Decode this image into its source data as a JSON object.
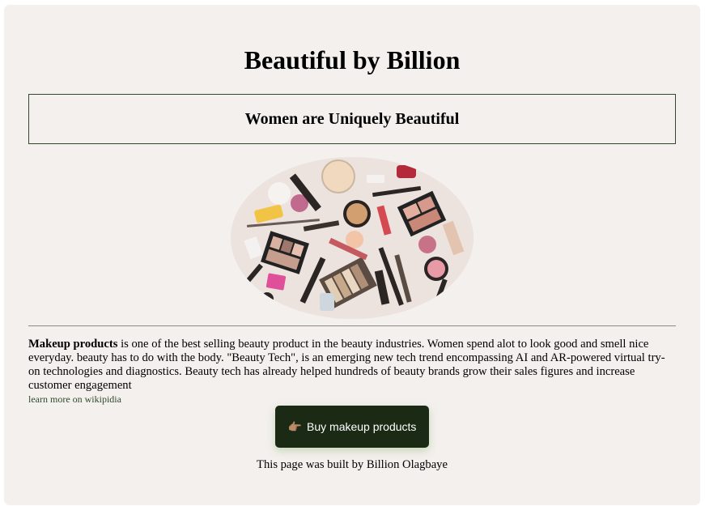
{
  "header": {
    "title": "Beautiful by Billion",
    "tagline": "Women are Uniquely Beautiful"
  },
  "hero": {
    "image_alt": "makeup products flat lay"
  },
  "content": {
    "bold_lead": "Makeup products",
    "paragraph": " is one of the best selling beauty product in the beauty industries. Women spend alot to look good and smell nice everyday. beauty has to do with the body. \"Beauty Tech\", is an emerging new tech trend encompassing AI and AR-powered virtual try-on technologies and diagnostics. Beauty tech has already helped hundreds of beauty brands grow their sales figures and increase customer engagement",
    "wiki_link": "learn more on wikipidia"
  },
  "cta": {
    "icon": "pointing-hand-icon",
    "glyph": "👉🏽",
    "label": "Buy makeup products"
  },
  "footer": {
    "credit": "This page was built by Billion Olagbaye"
  },
  "colors": {
    "card_background": "#f3f0ed",
    "border_green": "#2f4a2a",
    "button_background": "#1a2a14"
  }
}
